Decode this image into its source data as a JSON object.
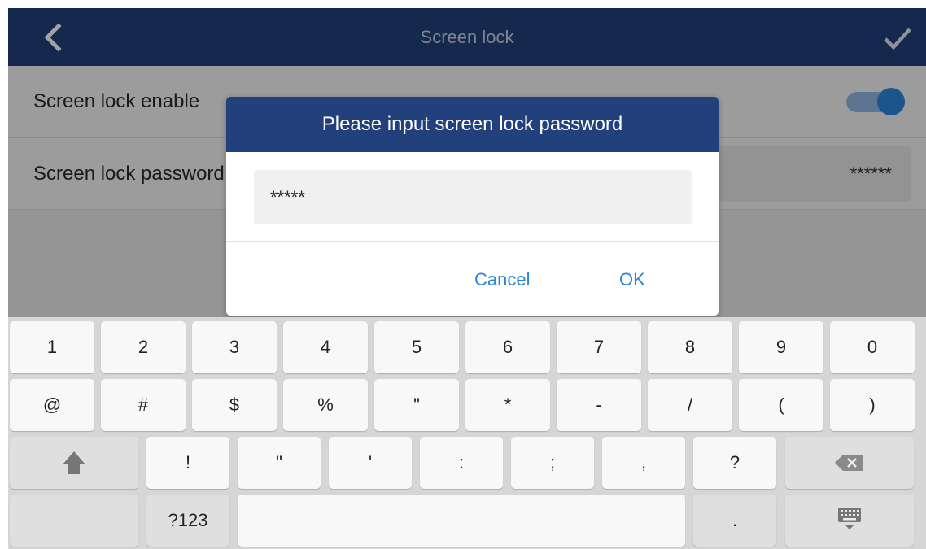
{
  "header": {
    "title": "Screen lock",
    "back_icon": "chevron-left-icon",
    "confirm_icon": "check-icon"
  },
  "settings": {
    "enable_label": "Screen lock enable",
    "enable_on": true,
    "password_label": "Screen lock password",
    "password_mask": "******"
  },
  "dialog": {
    "title": "Please input screen lock password",
    "input_value": "*****",
    "cancel_label": "Cancel",
    "ok_label": "OK"
  },
  "keyboard": {
    "row1": [
      "1",
      "2",
      "3",
      "4",
      "5",
      "6",
      "7",
      "8",
      "9",
      "0"
    ],
    "row2": [
      "@",
      "#",
      "$",
      "%",
      "\"",
      "*",
      "-",
      "/",
      "(",
      ")"
    ],
    "row3": [
      "!",
      "\"",
      "'",
      ":",
      ";",
      ",",
      "?"
    ],
    "row4": {
      "mode_label": "?123",
      "dot_label": "."
    },
    "shift_icon": "shift-icon",
    "backspace_icon": "backspace-icon",
    "hide_keyboard_icon": "keyboard-hide-icon"
  },
  "colors": {
    "header": "#22407c",
    "accent": "#2c86d6",
    "toggle_knob": "#2d86d8"
  }
}
